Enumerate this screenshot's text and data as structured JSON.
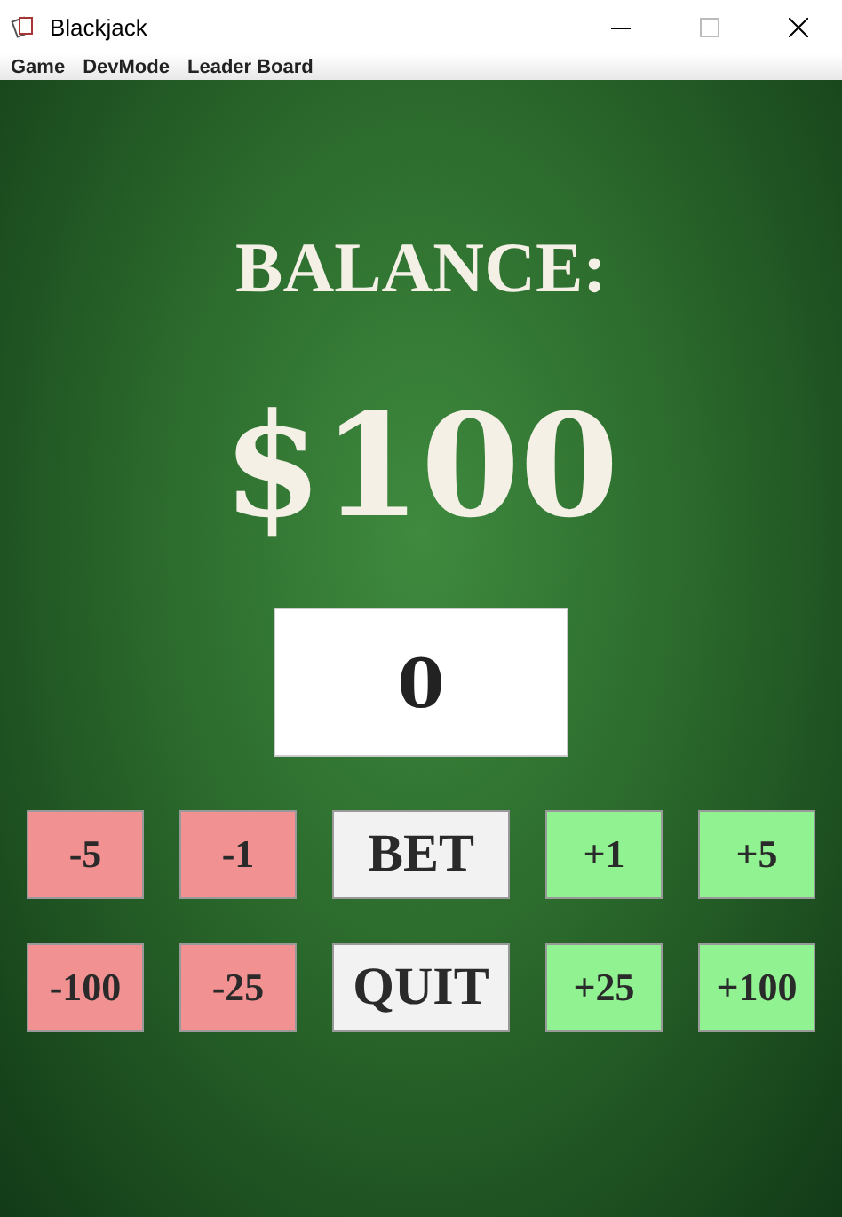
{
  "window": {
    "title": "Blackjack"
  },
  "menu": [
    "Game",
    "DevMode",
    "Leader Board"
  ],
  "balance": {
    "label": "BALANCE:",
    "amount": "$100"
  },
  "bet": {
    "value": "0"
  },
  "buttons": [
    {
      "label": "-5",
      "kind": "decrease"
    },
    {
      "label": "-1",
      "kind": "decrease"
    },
    {
      "label": "BET",
      "kind": "action"
    },
    {
      "label": "+1",
      "kind": "increase"
    },
    {
      "label": "+5",
      "kind": "increase"
    },
    {
      "label": "-100",
      "kind": "decrease"
    },
    {
      "label": "-25",
      "kind": "decrease"
    },
    {
      "label": "QUIT",
      "kind": "action"
    },
    {
      "label": "+25",
      "kind": "increase"
    },
    {
      "label": "+100",
      "kind": "increase"
    }
  ]
}
